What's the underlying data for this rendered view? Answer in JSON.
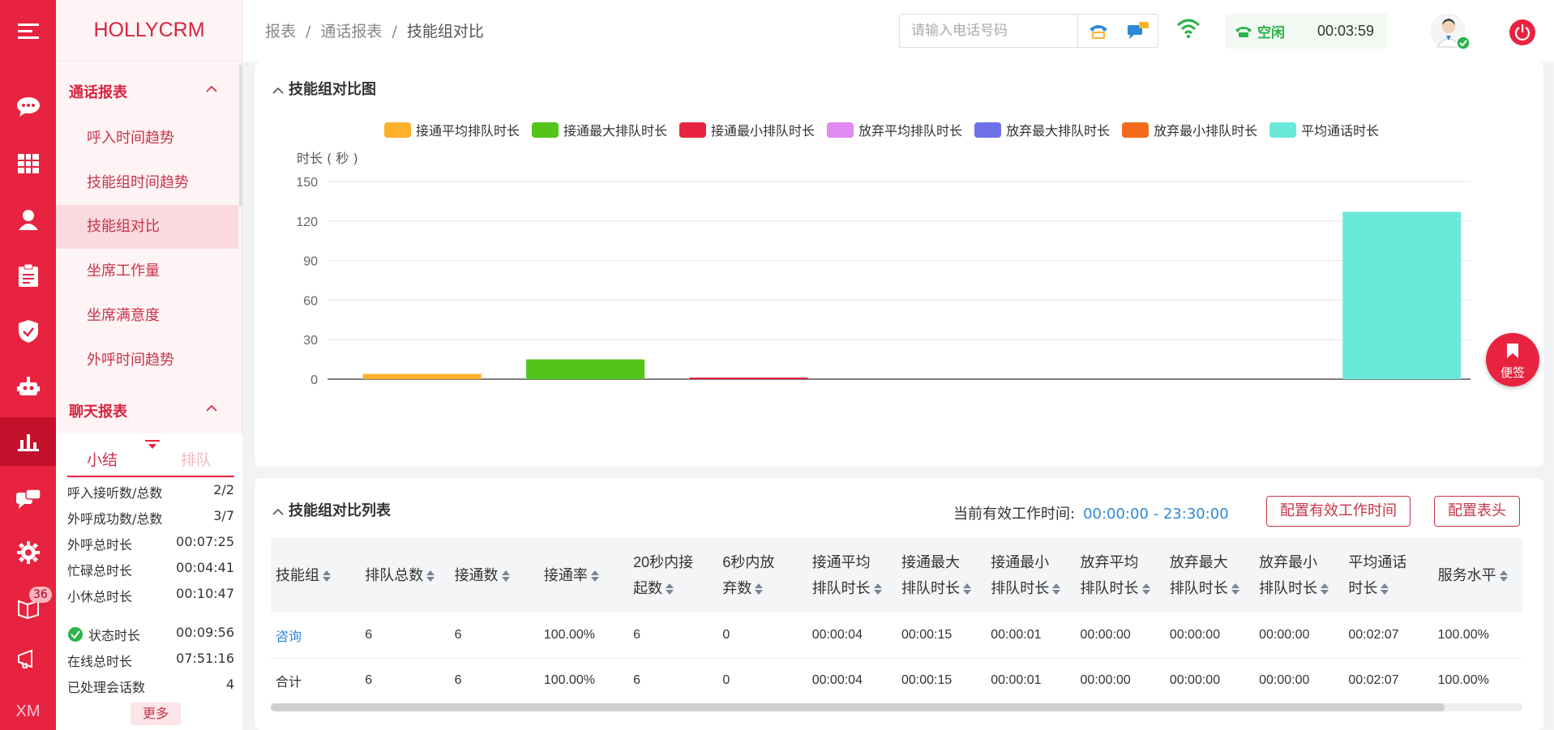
{
  "app": {
    "logo": "HOLLYCRM"
  },
  "rail": {
    "badge_count": "36",
    "footer": "XM"
  },
  "sidebar": {
    "groups": [
      {
        "label": "通话报表",
        "items": [
          "呼入时间趋势",
          "技能组时间趋势",
          "技能组对比",
          "坐席工作量",
          "坐席满意度",
          "外呼时间趋势"
        ]
      },
      {
        "label": "聊天报表"
      }
    ],
    "active_item": "技能组对比"
  },
  "stats": {
    "tabs": [
      "小结",
      "排队"
    ],
    "rows": [
      {
        "label": "呼入接听数/总数",
        "value": "2/2"
      },
      {
        "label": "外呼成功数/总数",
        "value": "3/7"
      },
      {
        "label": "外呼总时长",
        "value": "00:07:25"
      },
      {
        "label": "忙碌总时长",
        "value": "00:04:41"
      },
      {
        "label": "小休总时长",
        "value": "00:10:47"
      },
      {
        "label": "状态时长",
        "value": "00:09:56"
      },
      {
        "label": "在线总时长",
        "value": "07:51:16"
      },
      {
        "label": "已处理会话数",
        "value": "4"
      }
    ],
    "more": "更多"
  },
  "header": {
    "breadcrumb": [
      "报表",
      "通话报表",
      "技能组对比"
    ],
    "phone_placeholder": "请输入电话号码",
    "status_label": "空闲",
    "status_time": "00:03:59"
  },
  "chart_section": {
    "title": "技能组对比图"
  },
  "sticky_note": {
    "label": "便签"
  },
  "chart_data": {
    "type": "bar",
    "ylabel": "时长 ( 秒 )",
    "ylim": [
      0,
      150
    ],
    "yticks": [
      0,
      30,
      60,
      90,
      120,
      150
    ],
    "series": [
      {
        "name": "接通平均排队时长",
        "color": "#fdb12a",
        "values": [
          4
        ]
      },
      {
        "name": "接通最大排队时长",
        "color": "#52c41a",
        "values": [
          15
        ]
      },
      {
        "name": "接通最小排队时长",
        "color": "#e8233f",
        "values": [
          1
        ]
      },
      {
        "name": "放弃平均排队时长",
        "color": "#e18af0",
        "values": [
          0
        ]
      },
      {
        "name": "放弃最大排队时长",
        "color": "#6e70e8",
        "values": [
          0
        ]
      },
      {
        "name": "放弃最小排队时长",
        "color": "#f46a1c",
        "values": [
          0
        ]
      },
      {
        "name": "平均通话时长",
        "color": "#6ae8da",
        "values": [
          127
        ]
      }
    ]
  },
  "table_section": {
    "title": "技能组对比列表",
    "worktime_label": "当前有效工作时间:",
    "worktime_value": "00:00:00 - 23:30:00",
    "btn_config_time": "配置有效工作时间",
    "btn_config_header": "配置表头",
    "columns": [
      [
        "技能组"
      ],
      [
        "排队总数"
      ],
      [
        "接通数"
      ],
      [
        "接通率"
      ],
      [
        "20秒内接",
        "起数"
      ],
      [
        "6秒内放",
        "弃数"
      ],
      [
        "接通平均",
        "排队时长"
      ],
      [
        "接通最大",
        "排队时长"
      ],
      [
        "接通最小",
        "排队时长"
      ],
      [
        "放弃平均",
        "排队时长"
      ],
      [
        "放弃最大",
        "排队时长"
      ],
      [
        "放弃最小",
        "排队时长"
      ],
      [
        "平均通话",
        "时长"
      ],
      [
        "服务水平"
      ]
    ],
    "rows": [
      [
        "咨询",
        "6",
        "6",
        "100.00%",
        "6",
        "0",
        "00:00:04",
        "00:00:15",
        "00:00:01",
        "00:00:00",
        "00:00:00",
        "00:00:00",
        "00:02:07",
        "100.00%"
      ],
      [
        "合计",
        "6",
        "6",
        "100.00%",
        "6",
        "0",
        "00:00:04",
        "00:00:15",
        "00:00:01",
        "00:00:00",
        "00:00:00",
        "00:00:00",
        "00:02:07",
        "100.00%"
      ]
    ]
  }
}
